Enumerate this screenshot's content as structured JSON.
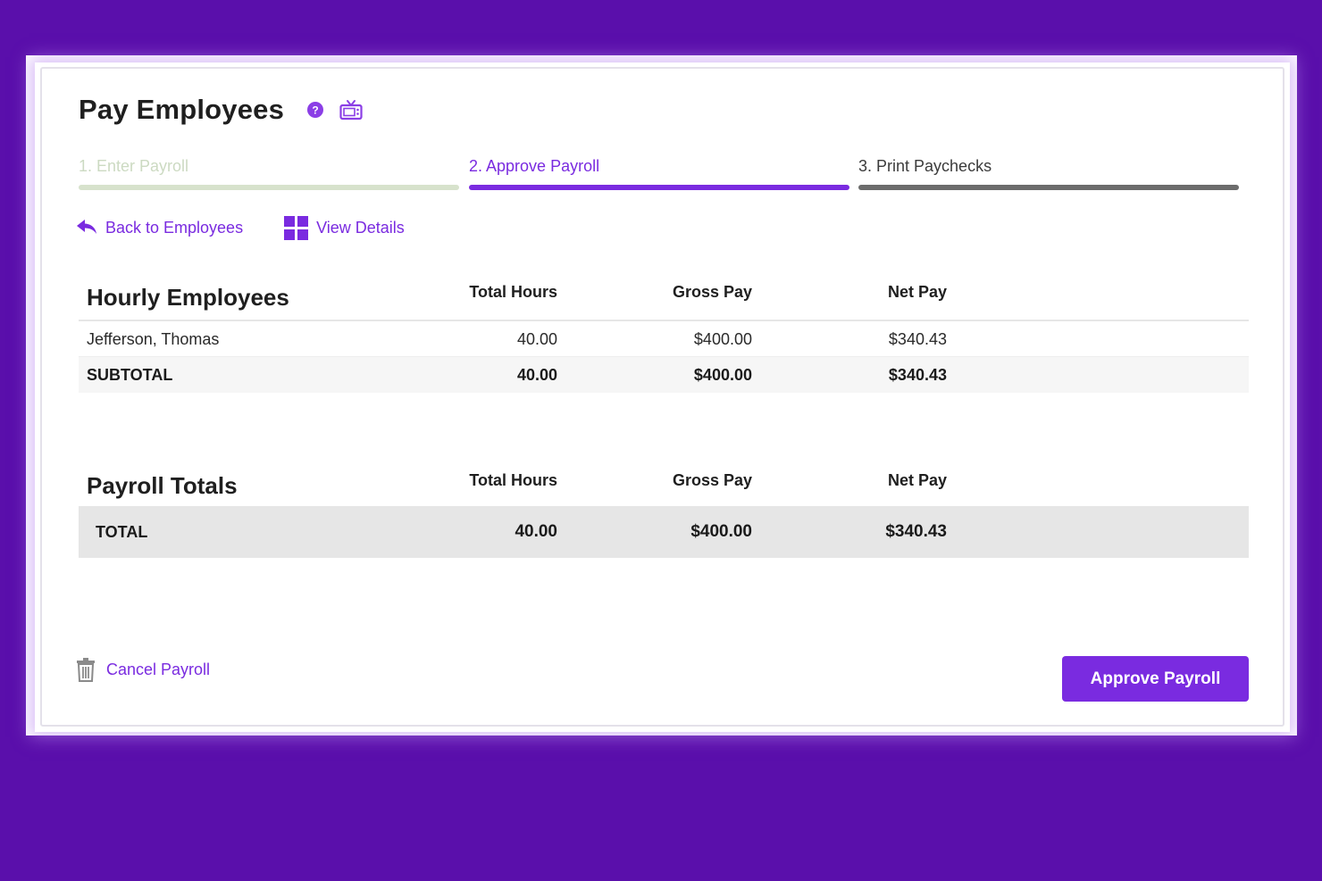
{
  "header": {
    "title": "Pay Employees",
    "help_icon": "question-circle-icon",
    "video_icon": "tv-icon"
  },
  "steps": [
    {
      "label": "1. Enter Payroll",
      "state": "completed"
    },
    {
      "label": "2. Approve Payroll",
      "state": "active"
    },
    {
      "label": "3. Print Paychecks",
      "state": "upcoming"
    }
  ],
  "links": {
    "back_label": "Back to Employees",
    "details_label": "View Details"
  },
  "hourly": {
    "title": "Hourly Employees",
    "columns": [
      "Total Hours",
      "Gross Pay",
      "Net Pay"
    ],
    "rows": [
      {
        "name": "Jefferson, Thomas",
        "hours": "40.00",
        "gross": "$400.00",
        "net": "$340.43"
      }
    ],
    "subtotal": {
      "label": "SUBTOTAL",
      "hours": "40.00",
      "gross": "$400.00",
      "net": "$340.43"
    }
  },
  "totals": {
    "title": "Payroll Totals",
    "columns": [
      "Total Hours",
      "Gross Pay",
      "Net Pay"
    ],
    "total": {
      "label": "TOTAL",
      "hours": "40.00",
      "gross": "$400.00",
      "net": "$340.43"
    }
  },
  "footer": {
    "cancel_label": "Cancel Payroll",
    "approve_label": "Approve Payroll"
  },
  "colors": {
    "background": "#5a0fab",
    "accent": "#7a2be0",
    "completed_step": "#d7e2cc",
    "upcoming_step": "#6c6c6c"
  }
}
